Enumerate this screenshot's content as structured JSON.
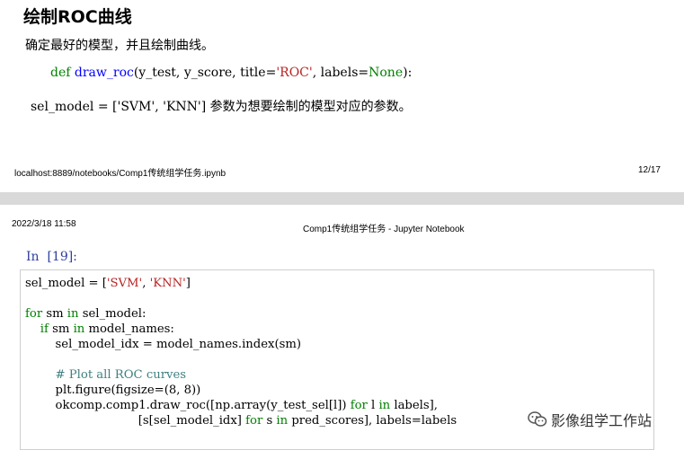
{
  "page1": {
    "section_title": "绘制ROC曲线",
    "intro": "确定最好的模型，并且绘制曲线。",
    "signature": {
      "def_kw": "def",
      "func_name": "draw_roc",
      "args_before_title": "(y_test, y_score, title=",
      "title_str": "'ROC'",
      "between": ", labels=",
      "none_kw": "None",
      "close": "):"
    },
    "explanation": {
      "code": "sel_model = ['SVM', 'KNN']",
      "text": " 参数为想要绘制的模型对应的参数。"
    },
    "footer_url": "localhost:8889/notebooks/Comp1传统组学任务.ipynb",
    "footer_page": "12/17"
  },
  "page2": {
    "header_date": "2022/3/18 11:58",
    "header_title": "Comp1传统组学任务 - Jupyter Notebook",
    "prompt": "In  [19]:",
    "code": {
      "l1_a": "sel_model = [",
      "l1_s1": "'SVM'",
      "l1_b": ", ",
      "l1_s2": "'KNN'",
      "l1_c": "]",
      "l3_for": "for",
      "l3_a": " sm ",
      "l3_in": "in",
      "l3_b": " sel_model:",
      "l4_indent": "    ",
      "l4_if": "if",
      "l4_a": " sm ",
      "l4_in": "in",
      "l4_b": " model_names:",
      "l5": "        sel_model_idx = model_names.index(sm)",
      "l7_indent": "        ",
      "l7_comment": "# Plot all ROC curves",
      "l8": "        plt.figure(figsize=(8, 8))",
      "l9_a": "        okcomp.comp1.draw_roc([np.array(y_test_sel[l]) ",
      "l9_for": "for",
      "l9_b": " l ",
      "l9_in": "in",
      "l9_c": " labels],",
      "l10_a": "                              [s[sel_model_idx] ",
      "l10_for": "for",
      "l10_b": " s ",
      "l10_in": "in",
      "l10_c": " pred_scores], labels=labels"
    }
  },
  "watermark": {
    "text": "影像组学工作站",
    "icon": "wechat-icon"
  },
  "colors": {
    "keyword": "#008000",
    "string": "#ba2121",
    "function": "#0000ff",
    "comment": "#408080",
    "prompt": "#303f9f",
    "page_gap": "#d9d9d9"
  }
}
